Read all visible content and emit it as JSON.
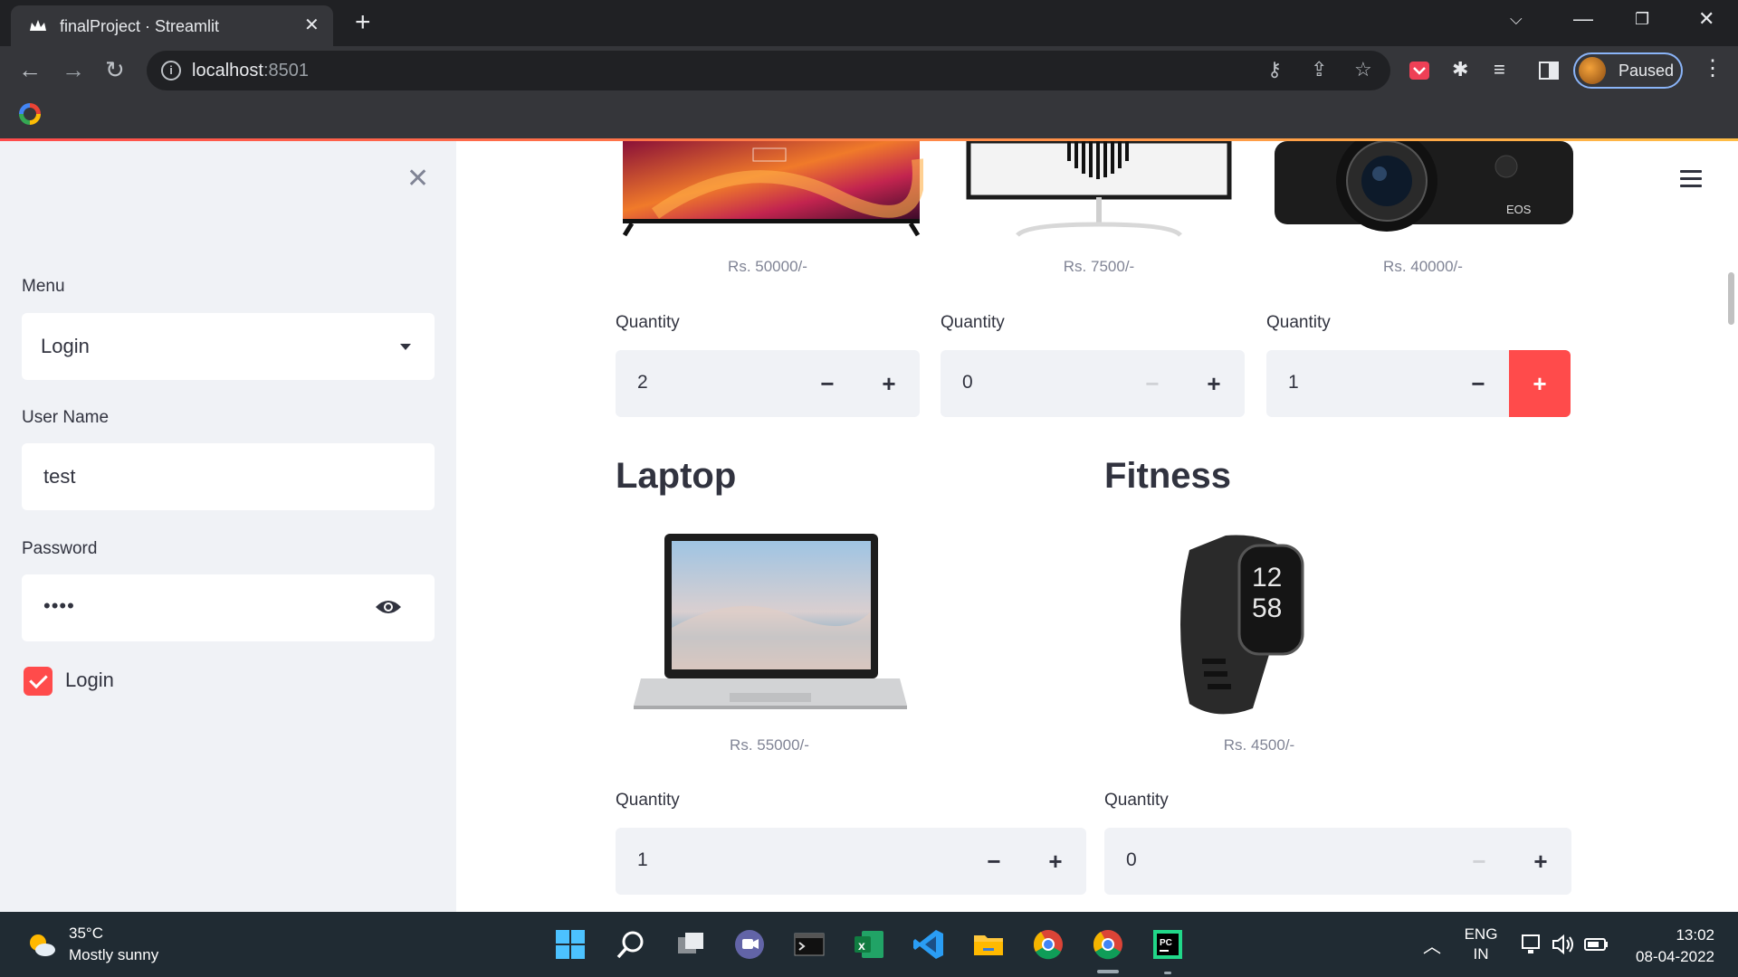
{
  "browser": {
    "tab_title": "finalProject · Streamlit",
    "url_host": "localhost",
    "url_port": ":8501",
    "profile_label": "Paused"
  },
  "sidebar": {
    "menu_label": "Menu",
    "menu_value": "Login",
    "username_label": "User Name",
    "username_value": "test",
    "password_label": "Password",
    "password_mask": "••••",
    "login_checkbox_label": "Login",
    "login_checked": true
  },
  "products_top": [
    {
      "name": "TV",
      "price": "Rs. 50000/-",
      "qty_label": "Quantity",
      "qty": "2"
    },
    {
      "name": "Monitor",
      "price": "Rs. 7500/-",
      "qty_label": "Quantity",
      "qty": "0"
    },
    {
      "name": "Camera",
      "price": "Rs. 40000/-",
      "qty_label": "Quantity",
      "qty": "1"
    }
  ],
  "sections": [
    {
      "title": "Laptop",
      "price": "Rs. 55000/-",
      "qty_label": "Quantity",
      "qty": "1"
    },
    {
      "title": "Fitness",
      "price": "Rs. 4500/-",
      "qty_label": "Quantity",
      "qty": "0"
    }
  ],
  "stepper": {
    "minus": "−",
    "plus": "+"
  },
  "taskbar": {
    "temperature": "35°C",
    "weather": "Mostly sunny",
    "lang_line1": "ENG",
    "lang_line2": "IN",
    "time": "13:02",
    "date": "08-04-2022"
  },
  "colors": {
    "accent": "#ff4b4b",
    "sidebar_bg": "#f0f2f6",
    "text": "#31333f",
    "muted": "#808495"
  }
}
